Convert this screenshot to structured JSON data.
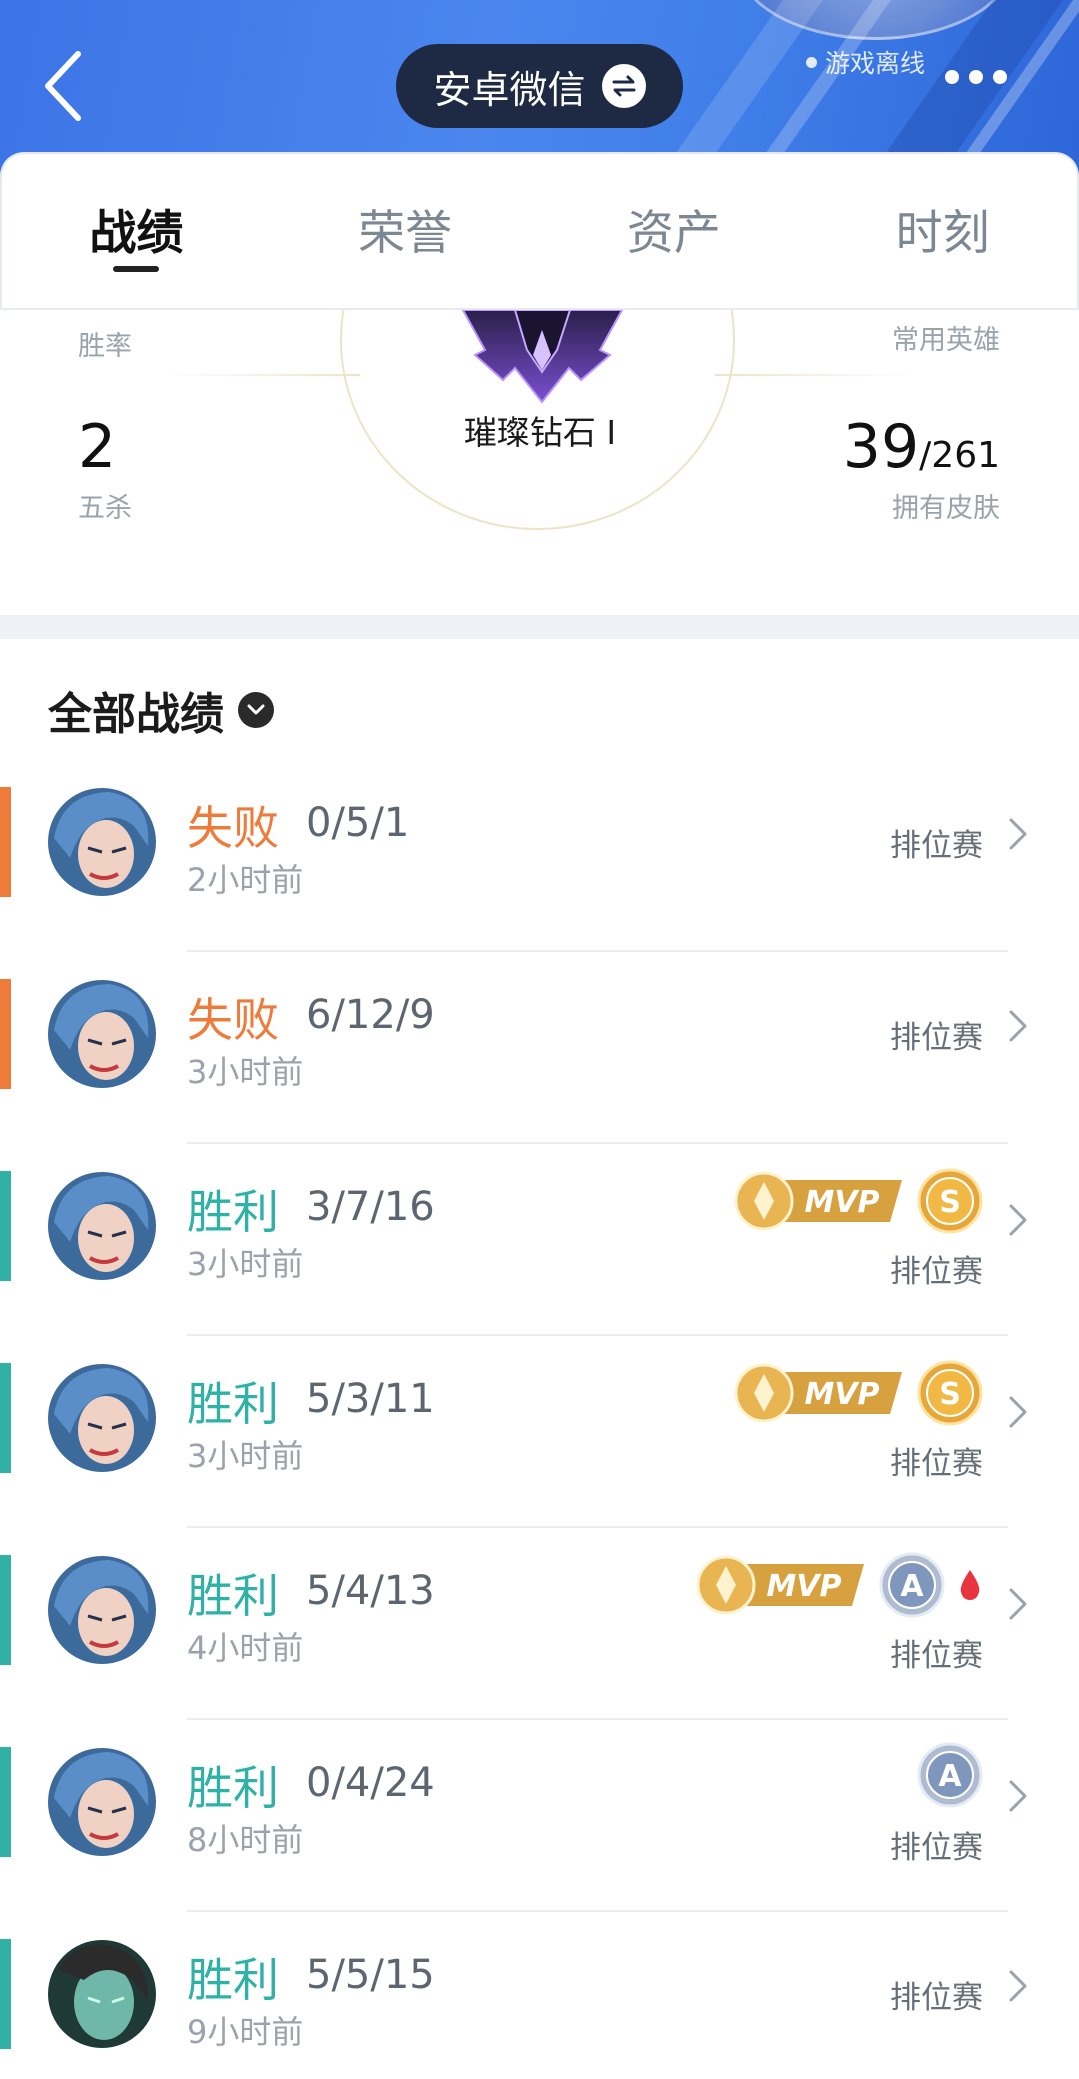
{
  "header": {
    "account": "安卓微信",
    "status": "游戏离线"
  },
  "tabs": [
    "战绩",
    "荣誉",
    "资产",
    "时刻"
  ],
  "stats": {
    "win_rate_label": "胜率",
    "favorite_hero_label": "常用英雄",
    "rank": "璀璨钻石 I",
    "penta_kills_value": "2",
    "penta_kills_label": "五杀",
    "skins_owned": "39",
    "skins_total": "/261",
    "skins_label": "拥有皮肤"
  },
  "records": {
    "title": "全部战绩",
    "items": [
      {
        "result": "失败",
        "kda": "0/5/1",
        "time": "2小时前",
        "mode": "排位赛",
        "outcome": "lose",
        "mvp": false,
        "medal": "",
        "blood": false
      },
      {
        "result": "失败",
        "kda": "6/12/9",
        "time": "3小时前",
        "mode": "排位赛",
        "outcome": "lose",
        "mvp": false,
        "medal": "",
        "blood": false
      },
      {
        "result": "胜利",
        "kda": "3/7/16",
        "time": "3小时前",
        "mode": "排位赛",
        "outcome": "win",
        "mvp": true,
        "medal": "S",
        "blood": false
      },
      {
        "result": "胜利",
        "kda": "5/3/11",
        "time": "3小时前",
        "mode": "排位赛",
        "outcome": "win",
        "mvp": true,
        "medal": "S",
        "blood": false
      },
      {
        "result": "胜利",
        "kda": "5/4/13",
        "time": "4小时前",
        "mode": "排位赛",
        "outcome": "win",
        "mvp": true,
        "medal": "A",
        "blood": true
      },
      {
        "result": "胜利",
        "kda": "0/4/24",
        "time": "8小时前",
        "mode": "排位赛",
        "outcome": "win",
        "mvp": false,
        "medal": "A",
        "blood": false
      },
      {
        "result": "胜利",
        "kda": "5/5/15",
        "time": "9小时前",
        "mode": "排位赛",
        "outcome": "win",
        "mvp": false,
        "medal": "",
        "blood": false
      }
    ]
  },
  "badge_labels": {
    "mvp": "MVP"
  },
  "colors": {
    "lose": "#ef7b3b",
    "win": "#2fb1a6",
    "header": "#3d74e6"
  },
  "icons": {
    "back": "chevron-left-icon",
    "swap": "swap-icon",
    "more": "more-icon",
    "dropdown": "chevron-down-icon",
    "row_arrow": "chevron-right-icon"
  }
}
